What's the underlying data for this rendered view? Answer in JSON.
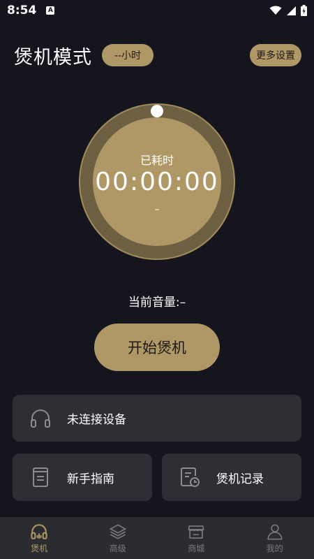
{
  "status_bar": {
    "time": "8:54",
    "notif_letter": "A"
  },
  "header": {
    "title": "煲机模式",
    "duration_label": "--小时",
    "more_settings_label": "更多设置"
  },
  "dial": {
    "elapsed_label": "已耗时",
    "elapsed_time": "00:00:00",
    "sub_value": "–"
  },
  "volume": {
    "text": "当前音量:–"
  },
  "start_button": {
    "label": "开始煲机"
  },
  "cards": {
    "device": {
      "label": "未连接设备",
      "icon": "headphones-icon"
    },
    "guide": {
      "label": "新手指南",
      "icon": "document-icon"
    },
    "records": {
      "label": "煲机记录",
      "icon": "record-clock-icon"
    }
  },
  "tabs": [
    {
      "label": "煲机",
      "icon": "headphones-icon",
      "active": true
    },
    {
      "label": "高级",
      "icon": "layers-icon",
      "active": false
    },
    {
      "label": "商城",
      "icon": "store-icon",
      "active": false
    },
    {
      "label": "我的",
      "icon": "person-icon",
      "active": false
    }
  ],
  "colors": {
    "accent": "#b09766",
    "background": "#15161d",
    "card": "#2e2f34",
    "tab_bar": "#2b2c30"
  }
}
